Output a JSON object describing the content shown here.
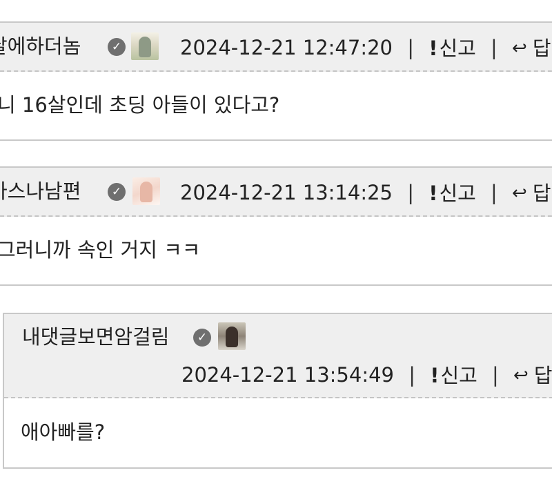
{
  "comments": [
    {
      "nickname": "날에하더놈",
      "verified_icon": "check-circle-icon",
      "avatar_icon": "user-avatar-image",
      "timestamp": "2024-12-21 12:47:20",
      "separator": "|",
      "report_label": "신고",
      "reply_label": "답",
      "body": "니 16살인데 초딩 아들이 있다고?"
    },
    {
      "nickname": "아스나남편",
      "verified_icon": "check-circle-icon",
      "avatar_icon": "user-avatar-image",
      "timestamp": "2024-12-21 13:14:25",
      "separator": "|",
      "report_label": "신고",
      "reply_label": "답",
      "body": "그러니까 속인 거지 ㅋㅋ"
    },
    {
      "nickname": "내댓글보면암걸림",
      "verified_icon": "check-circle-icon",
      "avatar_icon": "user-avatar-image",
      "timestamp": "2024-12-21 13:54:49",
      "separator": "|",
      "report_label": "신고",
      "reply_label": "답",
      "body": "애아빠를?"
    }
  ],
  "colors": {
    "header_bg": "#efefef",
    "border": "#c8c8c8",
    "badge": "#6f6f6f",
    "text": "#222222"
  }
}
